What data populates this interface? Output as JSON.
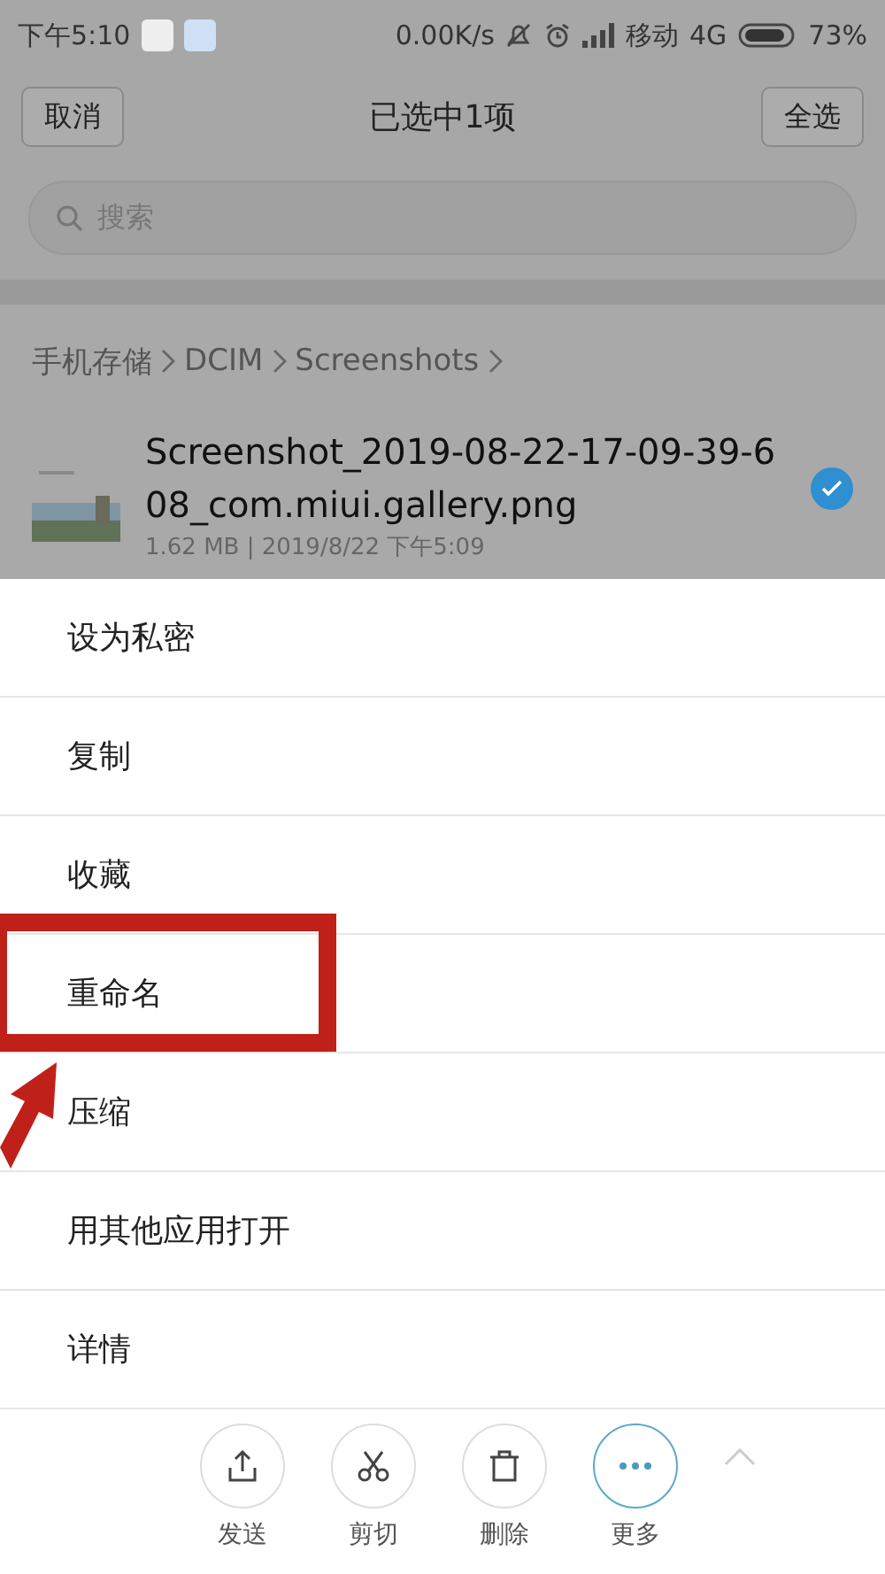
{
  "status_bar": {
    "time": "下午5:10",
    "speed": "0.00K/s",
    "carrier": "移动",
    "network": "4G",
    "battery": "73%"
  },
  "header": {
    "cancel": "取消",
    "title": "已选中1项",
    "select_all": "全选"
  },
  "search": {
    "placeholder": "搜索"
  },
  "breadcrumb": [
    "手机存储",
    "DCIM",
    "Screenshots"
  ],
  "file": {
    "name": "Screenshot_2019-08-22-17-09-39-608_com.miui.gallery.png",
    "meta": "1.62 MB | 2019/8/22 下午5:09",
    "selected": true
  },
  "menu": [
    "设为私密",
    "复制",
    "收藏",
    "重命名",
    "压缩",
    "用其他应用打开",
    "详情"
  ],
  "actions": [
    {
      "kind": "send",
      "label": "发送",
      "selected": false
    },
    {
      "kind": "cut",
      "label": "剪切",
      "selected": false
    },
    {
      "kind": "delete",
      "label": "删除",
      "selected": false
    },
    {
      "kind": "more",
      "label": "更多",
      "selected": true
    }
  ]
}
